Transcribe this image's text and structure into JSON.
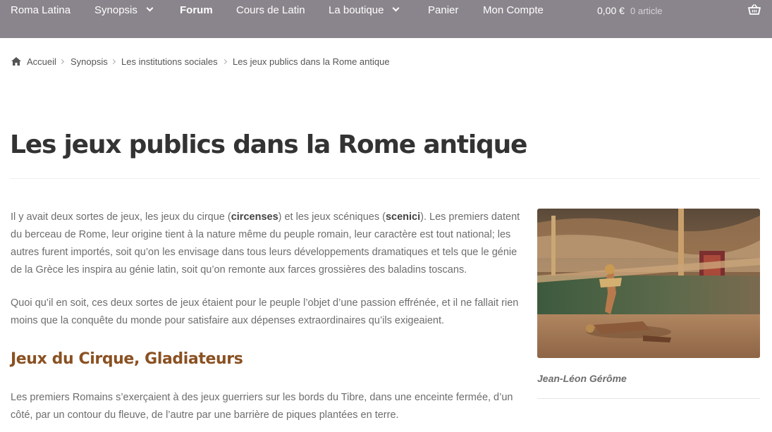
{
  "nav": {
    "brand": "Roma Latina",
    "items": [
      {
        "label": "Synopsis"
      },
      {
        "label": "Forum"
      },
      {
        "label": "Cours de Latin"
      },
      {
        "label": "La boutique"
      },
      {
        "label": "Panier"
      },
      {
        "label": "Mon Compte"
      }
    ],
    "cart_amount": "0,00 €",
    "cart_count": "0 article"
  },
  "breadcrumb": [
    "Accueil",
    "Synopsis",
    "Les institutions sociales",
    "Les jeux publics dans la Rome antique"
  ],
  "page": {
    "title": "Les jeux publics dans la Rome antique",
    "p1": {
      "a": "Il y avait deux sortes de jeux, les jeux du cirque (",
      "b1": "circenses",
      "c": ") et les jeux scéniques (",
      "b2": "scenici",
      "d": "). Les premiers datent du berceau de Rome, leur origine tient à la nature même du peuple romain, leur caractère est tout national; les autres furent importés, soit qu’on les envisage dans tous leurs développements dramatiques et tels que le génie de la Grèce les inspira au génie latin, soit qu’on remonte aux farces grossières des baladins toscans."
    },
    "p2": "Quoi qu’il en soit, ces deux sortes de jeux étaient pour le peuple l’objet d’une passion effrénée, et il ne fallait rien moins que la conquête du monde pour satisfaire aux dépenses extraordinaires qu’ils exigeaient.",
    "heading": "Jeux du Cirque, Gladiateurs",
    "p3": "Les premiers Romains s’exerçaient à des jeux guerriers sur les bords du Tibre, dans une enceinte fermée, d’un côté, par un contour du fleuve, de l’autre par une barrière de piques plantées en terre."
  },
  "sidebar": {
    "caption": "Jean-Léon Gérôme"
  },
  "icons": {
    "home": "home-icon",
    "basket": "basket-icon"
  },
  "colors": {
    "nav_bg": "#8a858c",
    "heading_brown": "#8a5122",
    "text": "#6d6d6d",
    "title": "#333333"
  }
}
